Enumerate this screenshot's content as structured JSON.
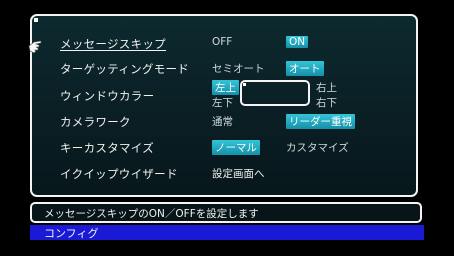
{
  "screen_title": "コンフィグ",
  "help_text": "メッセージスキップのON／OFFを設定します",
  "settings": {
    "message_skip": {
      "label": "メッセージスキップ",
      "options": [
        "OFF",
        "ON"
      ]
    },
    "targeting_mode": {
      "label": "ターゲッティングモード",
      "options": [
        "セミオート",
        "オート"
      ]
    },
    "window_color": {
      "label": "ウィンドウカラー",
      "options": [
        "左上",
        "右上",
        "左下",
        "右下"
      ]
    },
    "camera_work": {
      "label": "カメラワーク",
      "options": [
        "通常",
        "リーダー重視"
      ]
    },
    "key_customize": {
      "label": "キーカスタマイズ",
      "options": [
        "ノーマル",
        "カスタマイズ"
      ]
    },
    "equip_wizard": {
      "label": "イクイップウイザード",
      "action": "設定画面へ"
    }
  }
}
